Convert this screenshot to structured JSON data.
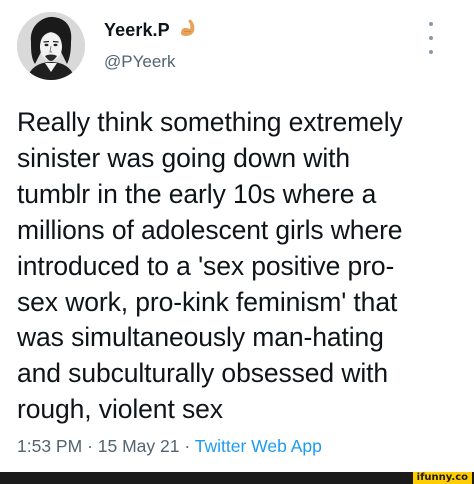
{
  "author": {
    "display_name": "Yeerk.P",
    "name_emoji": "flexed-arm-emoji",
    "handle": "@PYeerk",
    "avatar": "portrait-avatar"
  },
  "tweet": {
    "lines": [
      "Really think something extremely",
      "sinister was going down with",
      "tumblr in the early 10s where a",
      "millions of adolescent girls where",
      "introduced to a 'sex positive pro-",
      "sex work, pro-kink feminism' that",
      "was simultaneously man-hating",
      "and subculturally obsessed with",
      "rough, violent sex"
    ]
  },
  "meta": {
    "time": "1:53 PM",
    "separator": "·",
    "date": "15 May 21",
    "app": "Twitter Web App"
  },
  "icons": {
    "more": "more-options-icon"
  },
  "watermark": {
    "text": "ifunny.co"
  },
  "colors": {
    "text": "#0f1419",
    "secondary": "#536471",
    "link": "#1d9bf0",
    "watermark_bg": "#ffcc00"
  }
}
